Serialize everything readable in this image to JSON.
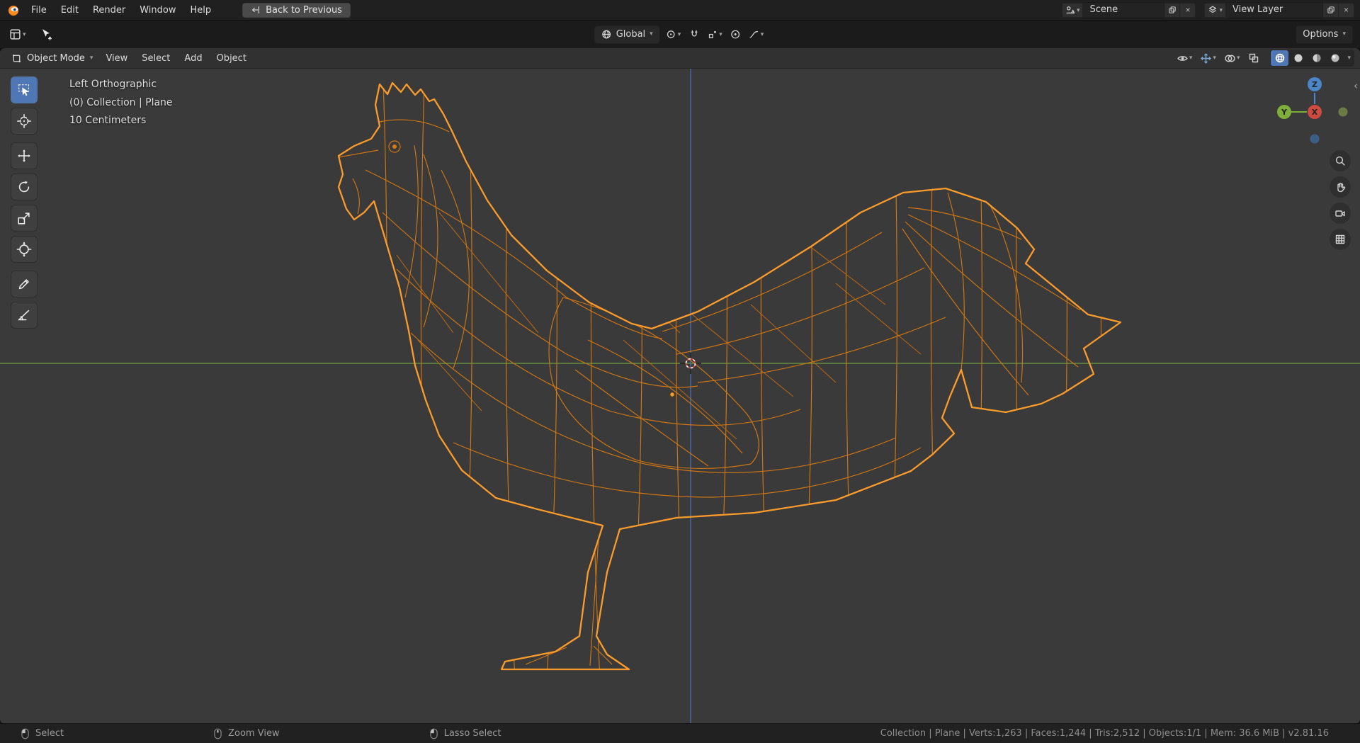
{
  "icons": {
    "chevron": "▾",
    "close": "×",
    "collapse": "‹"
  },
  "topbar": {
    "menus": [
      {
        "label": "File"
      },
      {
        "label": "Edit"
      },
      {
        "label": "Render"
      },
      {
        "label": "Window"
      },
      {
        "label": "Help"
      }
    ],
    "back_button": "Back to Previous",
    "scene_field": {
      "value": "Scene"
    },
    "view_layer_field": {
      "value": "View Layer"
    }
  },
  "tool_settings": {
    "orientation": "Global",
    "options_button": "Options"
  },
  "viewport": {
    "header": {
      "mode": "Object Mode",
      "menus": [
        {
          "label": "View"
        },
        {
          "label": "Select"
        },
        {
          "label": "Add"
        },
        {
          "label": "Object"
        }
      ]
    },
    "overlay": {
      "view_name": "Left Orthographic",
      "collection": "(0) Collection | Plane",
      "scale": "10 Centimeters"
    },
    "gizmo": {
      "x": "X",
      "y": "Y",
      "z": "Z"
    }
  },
  "colors": {
    "selected_wire": "#d97a10",
    "selection_outline": "#fb9b2c",
    "axis_y_green": "#6b9e3f",
    "axis_z_blue": "#4a6fb5",
    "active_tool_blue": "#4f76b5",
    "cursor_red": "#d84444",
    "viewport_background": "#3a3a3a"
  },
  "statusbar": {
    "hints": [
      {
        "label": "Select",
        "mouse": "left"
      },
      {
        "label": "Zoom View",
        "mouse": "middle"
      },
      {
        "label": "Lasso Select",
        "mouse": "left-drag"
      }
    ],
    "info": "Collection | Plane | Verts:1,263 | Faces:1,244 | Tris:2,512 | Objects:1/1 | Mem: 36.6 MiB | v2.81.16"
  }
}
